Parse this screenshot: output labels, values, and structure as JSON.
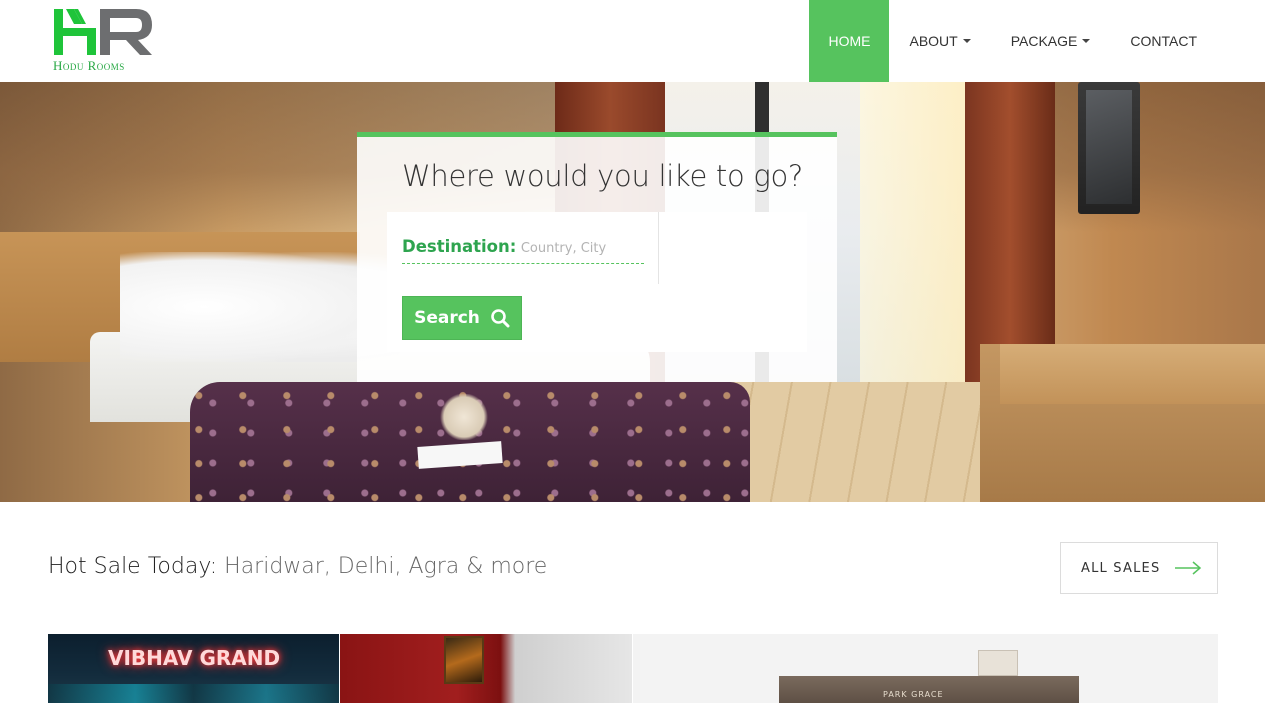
{
  "brand": {
    "logo_letters": "HR",
    "name": "Hodu Rooms",
    "colors": {
      "accent": "#56c35e",
      "brand_green": "#27a844",
      "brand_gray": "#6d6e70"
    }
  },
  "nav": {
    "items": [
      {
        "label": "HOME",
        "active": true,
        "dropdown": false
      },
      {
        "label": "ABOUT",
        "active": false,
        "dropdown": true
      },
      {
        "label": "PACKAGE",
        "active": false,
        "dropdown": true
      },
      {
        "label": "CONTACT",
        "active": false,
        "dropdown": false
      }
    ]
  },
  "hero": {
    "search": {
      "title": "Where would you like to go?",
      "destination_label": "Destination:",
      "destination_placeholder": "Country, City",
      "destination_value": "",
      "button_label": "Search",
      "button_icon": "search-icon"
    }
  },
  "hot_sale": {
    "label": "Hot Sale Today:",
    "cities": "Haridwar, Delhi, Agra & more",
    "all_sales_label": "ALL SALES",
    "all_sales_icon": "arrow-right-icon"
  },
  "hotels": [
    {
      "sign_text": "VIBHAV GRAND"
    },
    {
      "sign_text": ""
    },
    {
      "sign_text": "PARK GRACE"
    }
  ]
}
